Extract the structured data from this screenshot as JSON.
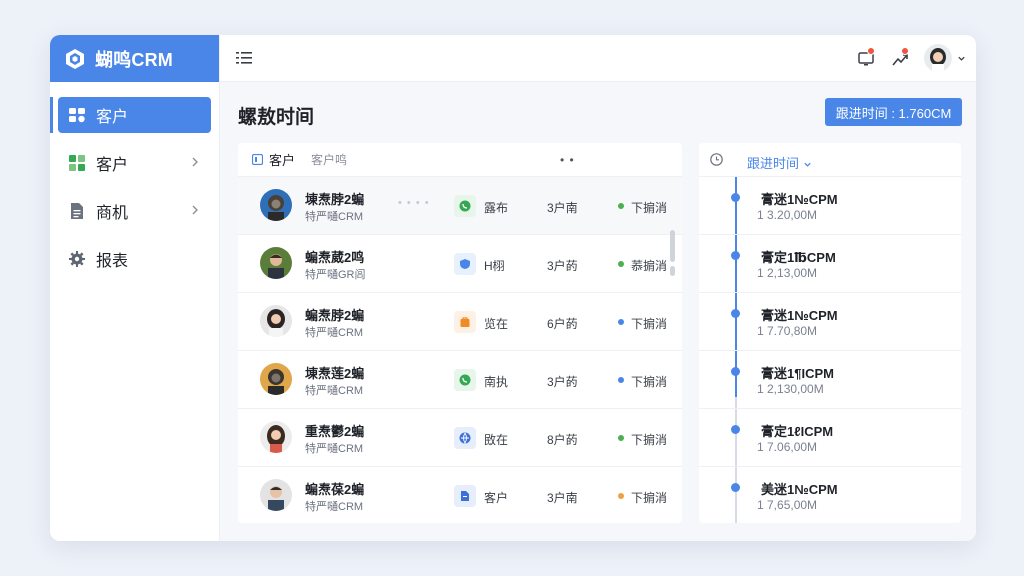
{
  "brand": {
    "name": "蝴鸣CRM"
  },
  "nav": {
    "items": [
      {
        "label": "客户",
        "active": true
      },
      {
        "label": "客户",
        "expandable": true
      },
      {
        "label": "商机",
        "expandable": true
      },
      {
        "label": "报表"
      }
    ]
  },
  "topbar": {},
  "page": {
    "title": "螺敖时间",
    "primary_button": "跟进时间 : 1.760CM"
  },
  "list": {
    "header_title": "客户",
    "header_tab": "客户鸣",
    "header_more": "• •",
    "rows": [
      {
        "name": "埬焘脖2蝙",
        "company": "特严嗵CRM",
        "dots": "• • • •",
        "tag": "露布",
        "count": "3户南",
        "status": "下掮消",
        "status_color": "#4caf50",
        "tag_color": "#e8f5ea",
        "icon_color": "#34a853"
      },
      {
        "name": "蝙焘葳2鸣",
        "company": "特严嗵GR闾",
        "dots": "",
        "tag": "H栩",
        "count": "3户菂",
        "status": "菾掮消",
        "status_color": "#4caf50",
        "tag_color": "#e6f1fd",
        "icon_color": "#4a86e8"
      },
      {
        "name": "蝙焘脖2蝙",
        "company": "特严嗵CRM",
        "dots": "",
        "tag": "览在",
        "count": "6户菂",
        "status": "下掮消",
        "status_color": "#4a86e8",
        "tag_color": "#fdf0e4",
        "icon_color": "#f08a24"
      },
      {
        "name": "埬焘莲2蝙",
        "company": "特严嗵CRM",
        "dots": "",
        "tag": "南执",
        "count": "3户菂",
        "status": "下掮消",
        "status_color": "#4a86e8",
        "tag_color": "#e8f5ea",
        "icon_color": "#34a853"
      },
      {
        "name": "重焘鬱2蝙",
        "company": "特严嗵CRM",
        "dots": "",
        "tag": "敃在",
        "count": "8户菂",
        "status": "下掮消",
        "status_color": "#4caf50",
        "tag_color": "#e6eefc",
        "icon_color": "#3d6fd8"
      },
      {
        "name": "蝙焘葆2蝙",
        "company": "特严嗵CRM",
        "dots": "",
        "tag": "客户",
        "count": "3户南",
        "status": "下掮消",
        "status_color": "#f0a040",
        "tag_color": "#e6eefc",
        "icon_color": "#3d6fd8"
      }
    ]
  },
  "timeline": {
    "filter_label": "跟进时间",
    "items": [
      {
        "title": "膏迷1№CPM",
        "sub": "1  3.20,00M"
      },
      {
        "title": "膏定1℔CPM",
        "sub": "1  2,13,00M"
      },
      {
        "title": "膏迷1№CPM",
        "sub": "1  7.70,80M"
      },
      {
        "title": "膏迷1¶ICPM",
        "sub": "1  2,130,00M"
      },
      {
        "title": "膏定1ℓICPM",
        "sub": "1  7.06,00M"
      },
      {
        "title": "美迷1№CPM",
        "sub": "1  7,65,00M"
      }
    ]
  },
  "colors": {
    "accent": "#4a86e8",
    "badge": "#f0533e"
  }
}
